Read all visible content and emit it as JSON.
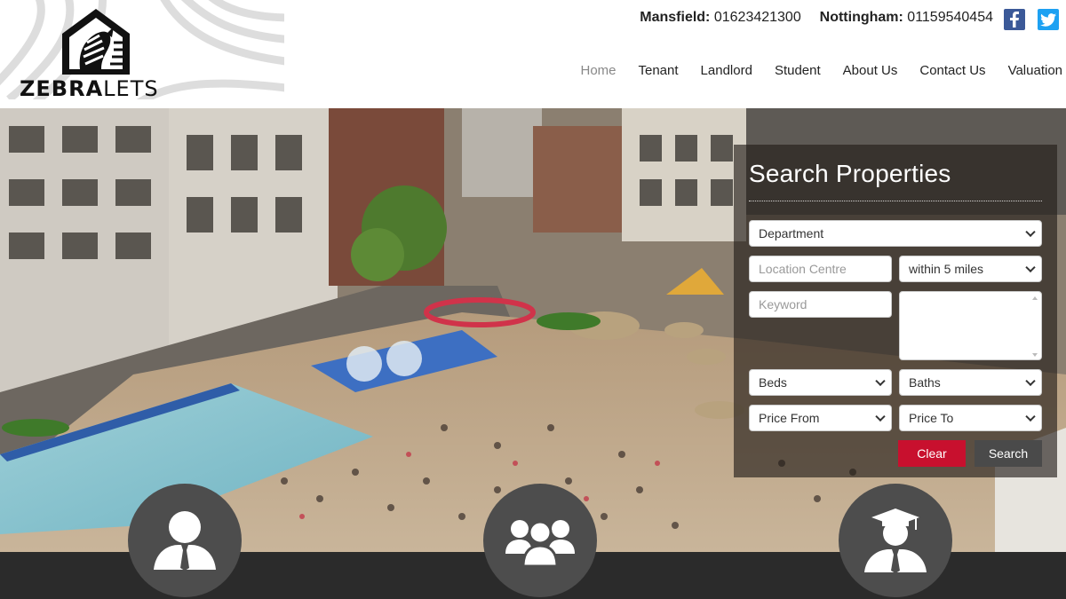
{
  "brand": {
    "name_bold": "ZEBRA",
    "name_light": "LETS"
  },
  "contact": {
    "offices": [
      {
        "city": "Mansfield:",
        "phone": "01623421300"
      },
      {
        "city": "Nottingham:",
        "phone": "01159540454"
      }
    ]
  },
  "social": {
    "facebook_icon": "facebook-icon",
    "twitter_icon": "twitter-icon"
  },
  "nav": {
    "items": [
      {
        "label": "Home",
        "active": true
      },
      {
        "label": "Tenant"
      },
      {
        "label": "Landlord"
      },
      {
        "label": "Student"
      },
      {
        "label": "About Us"
      },
      {
        "label": "Contact Us"
      },
      {
        "label": "Valuation"
      }
    ]
  },
  "search": {
    "title": "Search Properties",
    "department": "Department",
    "location_placeholder": "Location Centre",
    "radius": "within 5 miles",
    "keyword_placeholder": "Keyword",
    "beds": "Beds",
    "baths": "Baths",
    "price_from": "Price From",
    "price_to": "Price To",
    "clear_label": "Clear",
    "search_label": "Search"
  },
  "colors": {
    "accent_red": "#c8102e",
    "button_dark": "#4a4a4a",
    "facebook": "#3b5998",
    "twitter": "#1da1f2"
  },
  "features": [
    {
      "icon": "tenant-user-icon"
    },
    {
      "icon": "group-users-icon"
    },
    {
      "icon": "student-graduate-icon"
    }
  ]
}
